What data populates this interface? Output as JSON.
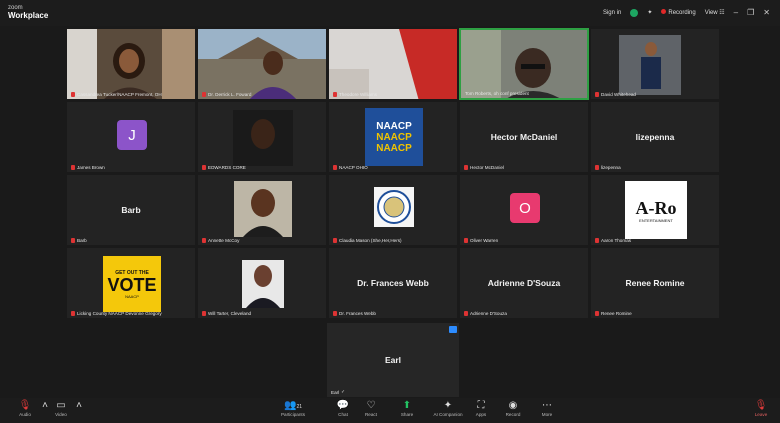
{
  "titlebar": {
    "brand_top": "zoom",
    "brand_bottom": "Workplace",
    "sign_in": "Sign in",
    "recording": "Recording",
    "view": "View"
  },
  "tiles": [
    {
      "id": "cassandrea",
      "name": "Cassandrea Tucker/NAACP Fremont, OH"
    },
    {
      "id": "derrick",
      "name": "Dr. Derrick L. Foward"
    },
    {
      "id": "theodore",
      "name": "Theodore Williams"
    },
    {
      "id": "tom",
      "name": "Tom Roberts, oh conf president"
    },
    {
      "id": "david",
      "name": "David Whitehead"
    },
    {
      "id": "james",
      "name": "James Brown",
      "initial": "J",
      "color": "#8c54c9"
    },
    {
      "id": "edwards",
      "name": "EDWARDS CORE"
    },
    {
      "id": "naacp",
      "name": "NAACP OHIO",
      "logo_text": "NAACP"
    },
    {
      "id": "hector",
      "name": "Hector McDaniel",
      "display": "Hector McDaniel"
    },
    {
      "id": "lizepenna",
      "name": "lizepenna",
      "display": "lizepenna"
    },
    {
      "id": "barb",
      "name": "Barb",
      "display": "Barb"
    },
    {
      "id": "annette",
      "name": "Annette McCoy"
    },
    {
      "id": "claudia",
      "name": "Claudia Mason (She,Her,Hers)"
    },
    {
      "id": "oliver",
      "name": "Oliver Warren",
      "initial": "O",
      "color": "#e83a6f"
    },
    {
      "id": "aaron",
      "name": "Aaron Thomas",
      "logo_text": "A-Ro",
      "logo_sub": "ENTERTAINMENT"
    },
    {
      "id": "licking",
      "name": "Licking County NAACP Devonne Gregory",
      "logo_top": "GET OUT THE",
      "logo_big": "VOTE",
      "logo_small": "NAACP"
    },
    {
      "id": "will",
      "name": "Will Tarter, Cleveland"
    },
    {
      "id": "frances",
      "name": "Dr. Frances Webb",
      "display": "Dr. Frances Webb"
    },
    {
      "id": "adrienne",
      "name": "Adrienne D'Souza",
      "display": "Adrienne D'Souza"
    },
    {
      "id": "renee",
      "name": "Renee Romine",
      "display": "Renee Romine"
    }
  ],
  "earl": {
    "display": "Earl",
    "name": "Earl"
  },
  "toolbar": {
    "audio": "Audio",
    "video": "Video",
    "participants": "Participants",
    "participants_count": "21",
    "chat": "Chat",
    "react": "React",
    "share": "Share",
    "ai": "AI Companion",
    "apps": "Apps",
    "record": "Record",
    "more": "More",
    "leave": "Leave"
  },
  "colors": {
    "active_border": "#2ea043",
    "naacp_blue": "#1f4f9a",
    "naacp_gold": "#f1c400",
    "vote_yellow": "#f4c80b"
  }
}
